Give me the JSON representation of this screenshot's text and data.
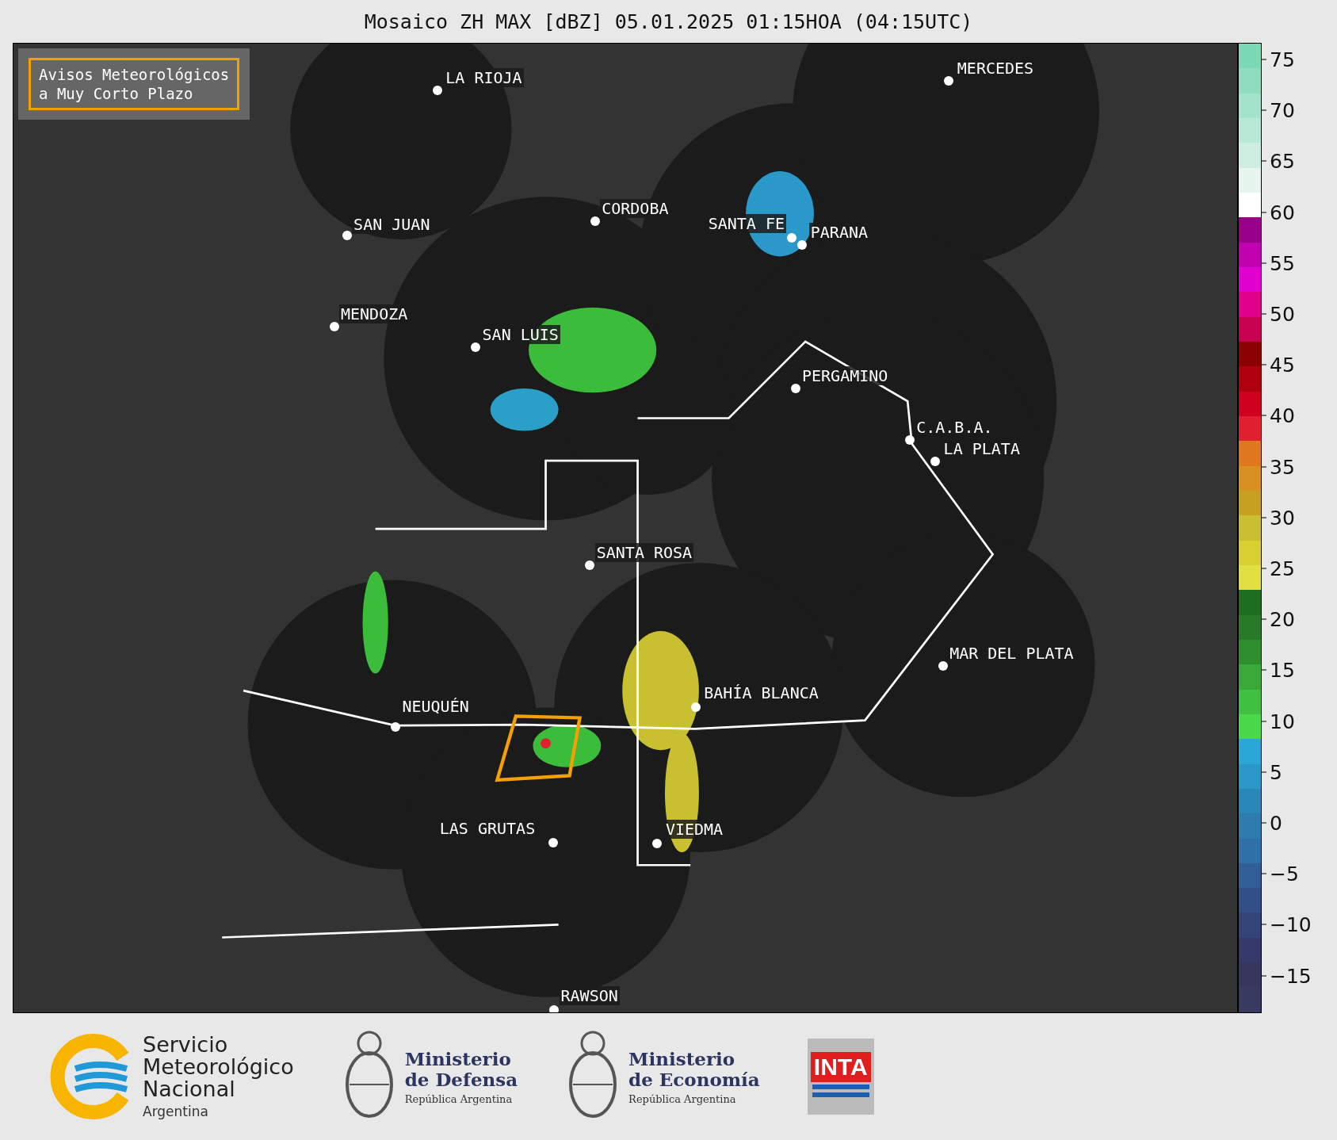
{
  "title": "Mosaico ZH MAX [dBZ] 05.01.2025 01:15HOA (04:15UTC)",
  "warning_box": {
    "lines": [
      "Avisos Meteorológicos",
      "a Muy Corto Plazo"
    ]
  },
  "cities": [
    {
      "name": "LA RIOJA"
    },
    {
      "name": "MERCEDES"
    },
    {
      "name": "CORDOBA"
    },
    {
      "name": "SAN JUAN"
    },
    {
      "name": "SANTA FE"
    },
    {
      "name": "PARANA"
    },
    {
      "name": "MENDOZA"
    },
    {
      "name": "SAN LUIS"
    },
    {
      "name": "PERGAMINO"
    },
    {
      "name": "C.A.B.A."
    },
    {
      "name": "LA PLATA"
    },
    {
      "name": "SANTA ROSA"
    },
    {
      "name": "MAR DEL PLATA"
    },
    {
      "name": "BAHÍA BLANCA"
    },
    {
      "name": "NEUQUÉN"
    },
    {
      "name": "LAS GRUTAS"
    },
    {
      "name": "VIEDMA"
    },
    {
      "name": "RAWSON"
    }
  ],
  "colorbar": {
    "ticks": [
      "75",
      "70",
      "65",
      "60",
      "55",
      "50",
      "45",
      "40",
      "35",
      "30",
      "25",
      "20",
      "15",
      "10",
      "5",
      "0",
      "−5",
      "−10",
      "−15"
    ]
  },
  "logos": [
    {
      "kind": "smn",
      "lines": [
        "Servicio",
        "Meteorológico",
        "Nacional"
      ],
      "subtitle": "Argentina"
    },
    {
      "kind": "ministry",
      "lines": [
        "Ministerio",
        "de Defensa"
      ],
      "subtitle": "República Argentina"
    },
    {
      "kind": "ministry",
      "lines": [
        "Ministerio",
        "de Economía"
      ],
      "subtitle": "República Argentina"
    },
    {
      "kind": "inta",
      "lines": [
        "INTA"
      ]
    }
  ]
}
